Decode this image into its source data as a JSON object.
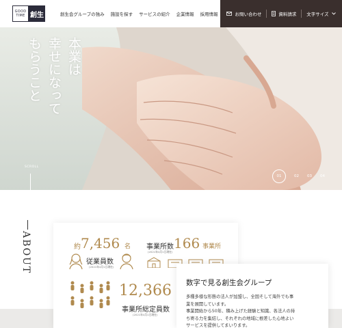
{
  "header": {
    "logo_top": "GOOD",
    "logo_bottom": "TIME",
    "logo_kanji": "創生",
    "nav": [
      "創生会グループの強み",
      "施設を探す",
      "サービスの紹介",
      "企業情報",
      "採用情報"
    ],
    "contact_label": "お問い合わせ",
    "request_label": "資料請求",
    "font_size_label": "文字サイズ",
    "contact_icon": "mail-icon",
    "request_icon": "document-icon",
    "font_size_icon": "chevron-down-icon"
  },
  "hero": {
    "catch_columns": [
      "本業は",
      "幸せになって",
      "もらうこと"
    ],
    "scroll_label": "SCROLL",
    "slides": [
      "01",
      "02",
      "03",
      "04"
    ],
    "active_slide": "01"
  },
  "about": {
    "title": "ABOUT",
    "employees": {
      "prefix": "約",
      "value": "7,456",
      "unit": "名",
      "label": "従業員数",
      "note": "(2021年4月1日現在)"
    },
    "offices": {
      "label_head": "事業所数",
      "value": "166",
      "unit": "事業所",
      "note": "(2021年4月1日現在)"
    },
    "total": {
      "value": "12,366",
      "label": "事業所総定員数",
      "note": "(2021年4月1日現在)"
    },
    "info_title": "数字で見る創生会グループ",
    "info_lines": [
      "多種多様な形態の法人が加盟し、全国そして海外でも事",
      "業を展開しています。",
      "事業開始から50年、積み上げた経験と知識、各法人の持",
      "ち寄る力を集結し、それぞれの地域に根差した心地よい",
      "サービスを提供してまいります。"
    ]
  },
  "colors": {
    "accent": "#b08a4e",
    "header_dark": "#3a2f2d",
    "logo": "#2b2b3a"
  }
}
